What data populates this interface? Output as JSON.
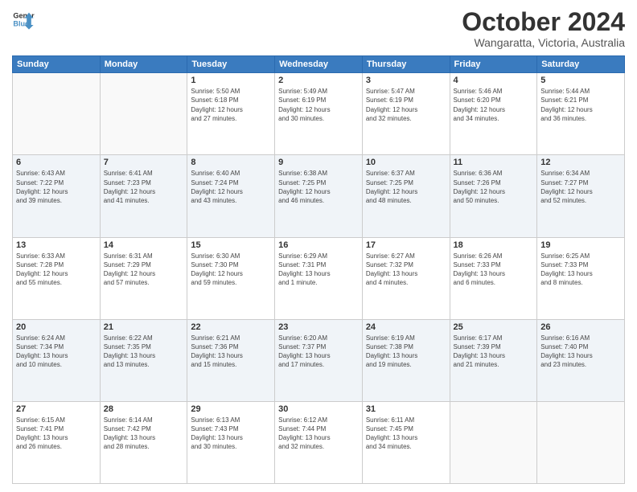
{
  "header": {
    "logo_line1": "General",
    "logo_line2": "Blue",
    "month": "October 2024",
    "location": "Wangaratta, Victoria, Australia"
  },
  "days_of_week": [
    "Sunday",
    "Monday",
    "Tuesday",
    "Wednesday",
    "Thursday",
    "Friday",
    "Saturday"
  ],
  "weeks": [
    [
      {
        "day": "",
        "info": ""
      },
      {
        "day": "",
        "info": ""
      },
      {
        "day": "1",
        "info": "Sunrise: 5:50 AM\nSunset: 6:18 PM\nDaylight: 12 hours\nand 27 minutes."
      },
      {
        "day": "2",
        "info": "Sunrise: 5:49 AM\nSunset: 6:19 PM\nDaylight: 12 hours\nand 30 minutes."
      },
      {
        "day": "3",
        "info": "Sunrise: 5:47 AM\nSunset: 6:19 PM\nDaylight: 12 hours\nand 32 minutes."
      },
      {
        "day": "4",
        "info": "Sunrise: 5:46 AM\nSunset: 6:20 PM\nDaylight: 12 hours\nand 34 minutes."
      },
      {
        "day": "5",
        "info": "Sunrise: 5:44 AM\nSunset: 6:21 PM\nDaylight: 12 hours\nand 36 minutes."
      }
    ],
    [
      {
        "day": "6",
        "info": "Sunrise: 6:43 AM\nSunset: 7:22 PM\nDaylight: 12 hours\nand 39 minutes."
      },
      {
        "day": "7",
        "info": "Sunrise: 6:41 AM\nSunset: 7:23 PM\nDaylight: 12 hours\nand 41 minutes."
      },
      {
        "day": "8",
        "info": "Sunrise: 6:40 AM\nSunset: 7:24 PM\nDaylight: 12 hours\nand 43 minutes."
      },
      {
        "day": "9",
        "info": "Sunrise: 6:38 AM\nSunset: 7:25 PM\nDaylight: 12 hours\nand 46 minutes."
      },
      {
        "day": "10",
        "info": "Sunrise: 6:37 AM\nSunset: 7:25 PM\nDaylight: 12 hours\nand 48 minutes."
      },
      {
        "day": "11",
        "info": "Sunrise: 6:36 AM\nSunset: 7:26 PM\nDaylight: 12 hours\nand 50 minutes."
      },
      {
        "day": "12",
        "info": "Sunrise: 6:34 AM\nSunset: 7:27 PM\nDaylight: 12 hours\nand 52 minutes."
      }
    ],
    [
      {
        "day": "13",
        "info": "Sunrise: 6:33 AM\nSunset: 7:28 PM\nDaylight: 12 hours\nand 55 minutes."
      },
      {
        "day": "14",
        "info": "Sunrise: 6:31 AM\nSunset: 7:29 PM\nDaylight: 12 hours\nand 57 minutes."
      },
      {
        "day": "15",
        "info": "Sunrise: 6:30 AM\nSunset: 7:30 PM\nDaylight: 12 hours\nand 59 minutes."
      },
      {
        "day": "16",
        "info": "Sunrise: 6:29 AM\nSunset: 7:31 PM\nDaylight: 13 hours\nand 1 minute."
      },
      {
        "day": "17",
        "info": "Sunrise: 6:27 AM\nSunset: 7:32 PM\nDaylight: 13 hours\nand 4 minutes."
      },
      {
        "day": "18",
        "info": "Sunrise: 6:26 AM\nSunset: 7:33 PM\nDaylight: 13 hours\nand 6 minutes."
      },
      {
        "day": "19",
        "info": "Sunrise: 6:25 AM\nSunset: 7:33 PM\nDaylight: 13 hours\nand 8 minutes."
      }
    ],
    [
      {
        "day": "20",
        "info": "Sunrise: 6:24 AM\nSunset: 7:34 PM\nDaylight: 13 hours\nand 10 minutes."
      },
      {
        "day": "21",
        "info": "Sunrise: 6:22 AM\nSunset: 7:35 PM\nDaylight: 13 hours\nand 13 minutes."
      },
      {
        "day": "22",
        "info": "Sunrise: 6:21 AM\nSunset: 7:36 PM\nDaylight: 13 hours\nand 15 minutes."
      },
      {
        "day": "23",
        "info": "Sunrise: 6:20 AM\nSunset: 7:37 PM\nDaylight: 13 hours\nand 17 minutes."
      },
      {
        "day": "24",
        "info": "Sunrise: 6:19 AM\nSunset: 7:38 PM\nDaylight: 13 hours\nand 19 minutes."
      },
      {
        "day": "25",
        "info": "Sunrise: 6:17 AM\nSunset: 7:39 PM\nDaylight: 13 hours\nand 21 minutes."
      },
      {
        "day": "26",
        "info": "Sunrise: 6:16 AM\nSunset: 7:40 PM\nDaylight: 13 hours\nand 23 minutes."
      }
    ],
    [
      {
        "day": "27",
        "info": "Sunrise: 6:15 AM\nSunset: 7:41 PM\nDaylight: 13 hours\nand 26 minutes."
      },
      {
        "day": "28",
        "info": "Sunrise: 6:14 AM\nSunset: 7:42 PM\nDaylight: 13 hours\nand 28 minutes."
      },
      {
        "day": "29",
        "info": "Sunrise: 6:13 AM\nSunset: 7:43 PM\nDaylight: 13 hours\nand 30 minutes."
      },
      {
        "day": "30",
        "info": "Sunrise: 6:12 AM\nSunset: 7:44 PM\nDaylight: 13 hours\nand 32 minutes."
      },
      {
        "day": "31",
        "info": "Sunrise: 6:11 AM\nSunset: 7:45 PM\nDaylight: 13 hours\nand 34 minutes."
      },
      {
        "day": "",
        "info": ""
      },
      {
        "day": "",
        "info": ""
      }
    ]
  ]
}
